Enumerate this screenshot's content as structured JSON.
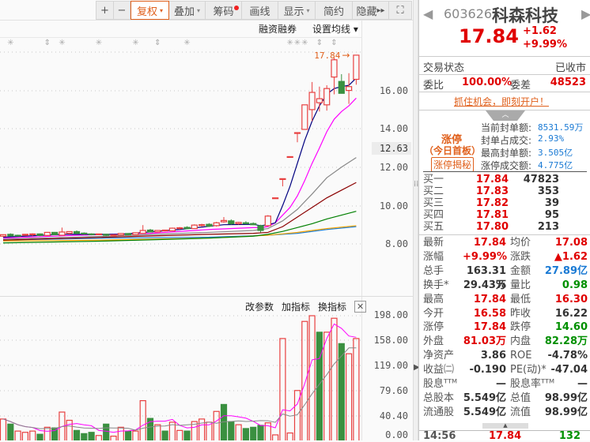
{
  "toolbar": {
    "zoom_in": "+",
    "zoom_out": "−",
    "fuquan": "复权",
    "overlay": "叠加",
    "chips": "筹码",
    "draw": "画线",
    "display": "显示",
    "simple": "简约",
    "hide": "隐藏",
    "hide_arrows": "▸▸",
    "fullscreen": "⛶",
    "dropdown": "▾"
  },
  "sub_toolbar": {
    "margin_trading": "融资融券",
    "set_ma": "设置均线 ▾"
  },
  "price_axis": {
    "labels": [
      "16.00",
      "14.00",
      "12.63",
      "12.00",
      "10.00",
      "8.00"
    ],
    "latest_tag": "17.84",
    "latest_arrow": "→"
  },
  "volume_panel": {
    "change_params": "改参数",
    "add_indicator": "加指标",
    "switch_indicator": "换指标",
    "close": "✕",
    "axis_labels": [
      "198.00",
      "158.00",
      "119.00",
      "79.60",
      "40.40",
      "0.00"
    ]
  },
  "colors": {
    "up": "#e84040",
    "down": "#3a9040",
    "ma5": "#000080",
    "ma10": "#ff00ff",
    "ma20": "#888888",
    "ma30": "#8b0000",
    "ma60": "#008000",
    "ma120": "#ffa500",
    "ma250": "#1e7fd4"
  },
  "candles": [
    [
      8.4,
      8.5,
      8.35,
      8.48
    ],
    [
      8.5,
      8.55,
      8.4,
      8.42
    ],
    [
      8.45,
      8.48,
      8.4,
      8.44
    ],
    [
      8.45,
      8.5,
      8.43,
      8.5
    ],
    [
      8.48,
      8.55,
      8.4,
      8.52
    ],
    [
      8.52,
      8.54,
      8.4,
      8.44
    ],
    [
      8.44,
      8.62,
      8.42,
      8.6
    ],
    [
      8.6,
      8.62,
      8.45,
      8.48
    ],
    [
      8.45,
      8.85,
      8.45,
      8.62
    ],
    [
      8.55,
      8.66,
      8.5,
      8.64
    ],
    [
      8.64,
      8.7,
      8.5,
      8.55
    ],
    [
      8.56,
      8.6,
      8.48,
      8.55
    ],
    [
      8.52,
      8.55,
      8.45,
      8.5
    ],
    [
      8.5,
      8.53,
      8.46,
      8.52
    ],
    [
      8.5,
      8.52,
      8.4,
      8.45
    ],
    [
      8.45,
      8.5,
      8.42,
      8.47
    ],
    [
      8.46,
      8.55,
      8.44,
      8.54
    ],
    [
      8.54,
      8.56,
      8.45,
      8.48
    ],
    [
      8.48,
      8.6,
      8.46,
      8.58
    ],
    [
      8.55,
      8.98,
      8.55,
      8.7
    ],
    [
      8.72,
      8.78,
      8.6,
      8.62
    ],
    [
      8.62,
      8.72,
      8.6,
      8.7
    ],
    [
      8.7,
      8.74,
      8.65,
      8.72
    ],
    [
      8.68,
      8.85,
      8.66,
      8.82
    ],
    [
      8.8,
      8.88,
      8.75,
      8.84
    ],
    [
      8.86,
      8.92,
      8.76,
      8.8
    ],
    [
      8.8,
      9.02,
      8.78,
      8.98
    ],
    [
      8.96,
      9.05,
      8.9,
      9.0
    ],
    [
      9.02,
      9.08,
      8.88,
      8.92
    ],
    [
      8.95,
      9.15,
      8.9,
      9.1
    ],
    [
      9.15,
      9.4,
      9.1,
      9.22
    ],
    [
      9.2,
      9.28,
      9.0,
      9.05
    ],
    [
      9.05,
      9.15,
      9.0,
      9.12
    ],
    [
      9.1,
      9.18,
      9.02,
      9.06
    ],
    [
      9.06,
      9.12,
      8.98,
      9.0
    ],
    [
      8.95,
      9.0,
      8.6,
      8.7
    ],
    [
      8.95,
      9.5,
      8.9,
      9.45
    ],
    [
      10.4,
      10.4,
      10.4,
      10.4
    ],
    [
      11.4,
      11.4,
      11.0,
      11.4
    ],
    [
      12.55,
      12.55,
      12.55,
      12.55
    ],
    [
      13.8,
      13.8,
      13.3,
      13.8
    ],
    [
      13.97,
      15.25,
      13.97,
      15.25
    ],
    [
      15.0,
      16.44,
      14.4,
      15.9
    ],
    [
      15.36,
      16.2,
      14.9,
      15.57
    ],
    [
      15.25,
      16.27,
      14.95,
      16.1
    ],
    [
      16.7,
      17.7,
      15.8,
      17.6
    ],
    [
      16.47,
      16.85,
      15.85,
      15.85
    ],
    [
      16.0,
      16.9,
      15.3,
      16.2
    ],
    [
      16.58,
      17.84,
      16.3,
      17.84
    ]
  ],
  "ma_lines": [
    {
      "name": "MA5",
      "color": "#000080",
      "points": [
        [
          0,
          8.35
        ],
        [
          8,
          8.5
        ],
        [
          16,
          8.5
        ],
        [
          24,
          8.75
        ],
        [
          30,
          9.0
        ],
        [
          34,
          9.02
        ],
        [
          35,
          8.95
        ],
        [
          36,
          9.0
        ],
        [
          37,
          9.1
        ],
        [
          38,
          10.0
        ],
        [
          39,
          11.0
        ],
        [
          40,
          12.2
        ],
        [
          41,
          13.4
        ],
        [
          42,
          14.4
        ],
        [
          43,
          15.2
        ],
        [
          44,
          15.8
        ],
        [
          45,
          16.1
        ],
        [
          46,
          16.2
        ],
        [
          47,
          16.27
        ],
        [
          48,
          16.65
        ]
      ]
    },
    {
      "name": "MA10",
      "color": "#ff00ff",
      "points": [
        [
          0,
          8.3
        ],
        [
          10,
          8.45
        ],
        [
          20,
          8.55
        ],
        [
          28,
          8.75
        ],
        [
          34,
          8.85
        ],
        [
          35,
          8.85
        ],
        [
          36,
          8.9
        ],
        [
          37,
          9.1
        ],
        [
          38,
          9.5
        ],
        [
          39,
          9.9
        ],
        [
          40,
          10.5
        ],
        [
          41,
          11.3
        ],
        [
          42,
          12.2
        ],
        [
          43,
          13.0
        ],
        [
          44,
          13.85
        ],
        [
          45,
          14.5
        ],
        [
          46,
          14.9
        ],
        [
          47,
          15.2
        ],
        [
          48,
          15.6
        ]
      ]
    },
    {
      "name": "MA20",
      "color": "#888888",
      "points": [
        [
          0,
          8.25
        ],
        [
          14,
          8.4
        ],
        [
          28,
          8.6
        ],
        [
          34,
          8.7
        ],
        [
          36,
          8.8
        ],
        [
          38,
          9.2
        ],
        [
          40,
          9.8
        ],
        [
          42,
          10.6
        ],
        [
          44,
          11.45
        ],
        [
          46,
          12.0
        ],
        [
          48,
          12.5
        ]
      ]
    },
    {
      "name": "MA30",
      "color": "#8b0000",
      "points": [
        [
          0,
          8.2
        ],
        [
          14,
          8.35
        ],
        [
          28,
          8.5
        ],
        [
          34,
          8.55
        ],
        [
          36,
          8.6
        ],
        [
          38,
          8.9
        ],
        [
          40,
          9.4
        ],
        [
          42,
          9.9
        ],
        [
          44,
          10.4
        ],
        [
          46,
          10.8
        ],
        [
          48,
          11.2
        ]
      ]
    },
    {
      "name": "MA60",
      "color": "#008000",
      "points": [
        [
          0,
          8.05
        ],
        [
          14,
          8.15
        ],
        [
          28,
          8.3
        ],
        [
          34,
          8.4
        ],
        [
          36,
          8.5
        ],
        [
          38,
          8.65
        ],
        [
          40,
          8.85
        ],
        [
          42,
          9.05
        ],
        [
          44,
          9.3
        ],
        [
          46,
          9.5
        ],
        [
          48,
          9.7
        ]
      ]
    },
    {
      "name": "MA120",
      "color": "#ffa500",
      "points": [
        [
          0,
          8.15
        ],
        [
          14,
          8.2
        ],
        [
          28,
          8.3
        ],
        [
          36,
          8.45
        ],
        [
          40,
          8.6
        ],
        [
          44,
          8.8
        ],
        [
          48,
          8.95
        ]
      ]
    },
    {
      "name": "MA250",
      "color": "#1e7fd4",
      "points": [
        [
          0,
          8.2
        ],
        [
          14,
          8.3
        ],
        [
          28,
          8.35
        ],
        [
          36,
          8.45
        ],
        [
          40,
          8.55
        ],
        [
          44,
          8.75
        ],
        [
          48,
          8.9
        ]
      ]
    }
  ],
  "volumes": [
    [
      35,
      "r"
    ],
    [
      27,
      "g"
    ],
    [
      16,
      "r"
    ],
    [
      14,
      "r"
    ],
    [
      16,
      "r"
    ],
    [
      11,
      "g"
    ],
    [
      22,
      "r"
    ],
    [
      21,
      "g"
    ],
    [
      46,
      "r"
    ],
    [
      33,
      "r"
    ],
    [
      17,
      "g"
    ],
    [
      12,
      "g"
    ],
    [
      14,
      "g"
    ],
    [
      9,
      "r"
    ],
    [
      27,
      "g"
    ],
    [
      8,
      "r"
    ],
    [
      22,
      "r"
    ],
    [
      16,
      "g"
    ],
    [
      16,
      "r"
    ],
    [
      64,
      "r"
    ],
    [
      36,
      "g"
    ],
    [
      26,
      "r"
    ],
    [
      16,
      "g"
    ],
    [
      30,
      "r"
    ],
    [
      17,
      "r"
    ],
    [
      16,
      "g"
    ],
    [
      31,
      "r"
    ],
    [
      35,
      "r"
    ],
    [
      30,
      "r"
    ],
    [
      47,
      "r"
    ],
    [
      58,
      "g"
    ],
    [
      31,
      "g"
    ],
    [
      26,
      "r"
    ],
    [
      20,
      "g"
    ],
    [
      22,
      "g"
    ],
    [
      25,
      "g"
    ],
    [
      29,
      "r"
    ],
    [
      10,
      "r"
    ],
    [
      162,
      "r"
    ],
    [
      13,
      "r"
    ],
    [
      80,
      "r"
    ],
    [
      189,
      "r"
    ],
    [
      198,
      "r"
    ],
    [
      172,
      "g"
    ],
    [
      172,
      "r"
    ],
    [
      194,
      "r"
    ],
    [
      154,
      "g"
    ],
    [
      138,
      "r"
    ],
    [
      162,
      "r"
    ]
  ],
  "markers": [
    {
      "i": 1,
      "t": "✳"
    },
    {
      "i": 6,
      "t": "⇕"
    },
    {
      "i": 8,
      "t": "✳"
    },
    {
      "i": 13,
      "t": "✳"
    },
    {
      "i": 18,
      "t": "✳"
    },
    {
      "i": 21,
      "t": "⇕"
    },
    {
      "i": 25,
      "t": "✳"
    },
    {
      "i": 39,
      "t": "✳"
    },
    {
      "i": 40,
      "t": "✳"
    },
    {
      "i": 41,
      "t": "✳"
    },
    {
      "i": 43,
      "t": "⇕"
    },
    {
      "i": 45,
      "t": "⇕"
    }
  ],
  "quote": {
    "code": "603626",
    "name": "科森科技",
    "price": "17.84",
    "change": "+1.62",
    "change_pct": "+9.99%",
    "status_label": "交易状态",
    "status_value": "已收市",
    "weibi_label": "委比",
    "weibi_value": "100.00%",
    "weicha_label": "委差",
    "weicha_value": "48523",
    "promo": "抓住机会，即刻开户！"
  },
  "limit_up": {
    "title": "涨停",
    "subtitle": "（今日首板）",
    "button": "涨停揭秘",
    "rows": [
      {
        "label": "当前封单额:",
        "value": "8531.59万"
      },
      {
        "label": "封单占成交:",
        "value": "2.93%"
      },
      {
        "label": "最高封单额:",
        "value": "3.505亿"
      },
      {
        "label": "涨停成交额:",
        "value": "4.775亿"
      }
    ]
  },
  "order_book": [
    {
      "label": "买一",
      "price": "17.84",
      "vol": "47823"
    },
    {
      "label": "买二",
      "price": "17.83",
      "vol": "353"
    },
    {
      "label": "买三",
      "price": "17.82",
      "vol": "39"
    },
    {
      "label": "买四",
      "price": "17.81",
      "vol": "95"
    },
    {
      "label": "买五",
      "price": "17.80",
      "vol": "213"
    }
  ],
  "stats": [
    {
      "l1": "最新",
      "v1": "17.84",
      "c1": "red",
      "l2": "均价",
      "v2": "17.08",
      "c2": "red"
    },
    {
      "l1": "涨幅",
      "v1": "+9.99%",
      "c1": "red",
      "l2": "涨跌",
      "v2": "▲1.62",
      "c2": "red"
    },
    {
      "l1": "总手",
      "v1": "163.31万",
      "c1": "dark",
      "l2": "金额",
      "v2": "27.89亿",
      "c2": "blue"
    },
    {
      "l1": "换手*",
      "v1": "29.43%",
      "c1": "dark",
      "l2": "量比",
      "v2": "0.98",
      "c2": "green"
    },
    {
      "l1": "最高",
      "v1": "17.84",
      "c1": "red",
      "l2": "最低",
      "v2": "16.30",
      "c2": "red"
    },
    {
      "l1": "今开",
      "v1": "16.58",
      "c1": "red",
      "l2": "昨收",
      "v2": "16.22",
      "c2": "dark"
    },
    {
      "l1": "涨停",
      "v1": "17.84",
      "c1": "red",
      "l2": "跌停",
      "v2": "14.60",
      "c2": "green"
    },
    {
      "l1": "外盘",
      "v1": "81.03万",
      "c1": "red",
      "l2": "内盘",
      "v2": "82.28万",
      "c2": "green"
    },
    {
      "l1": "净资产",
      "v1": "3.86",
      "c1": "dark",
      "l2": "ROE",
      "v2": "-4.78%",
      "c2": "dark"
    },
    {
      "l1": "收益㈡",
      "v1": "-0.190",
      "c1": "dark",
      "l2": "PE(动)*",
      "v2": "-47.04",
      "c2": "dark"
    },
    {
      "l1": "股息ᵀᵀᴹ",
      "v1": "—",
      "c1": "dark",
      "l2": "股息率ᵀᵀᴹ",
      "v2": "—",
      "c2": "dark"
    },
    {
      "l1": "总股本",
      "v1": "5.549亿",
      "c1": "dark",
      "l2": "总值",
      "v2": "98.99亿",
      "c2": "dark"
    },
    {
      "l1": "流通股",
      "v1": "5.549亿",
      "c1": "dark",
      "l2": "流值",
      "v2": "98.99亿",
      "c2": "dark"
    }
  ],
  "tick": {
    "time": "14:56",
    "price": "17.84",
    "vol": "132"
  }
}
